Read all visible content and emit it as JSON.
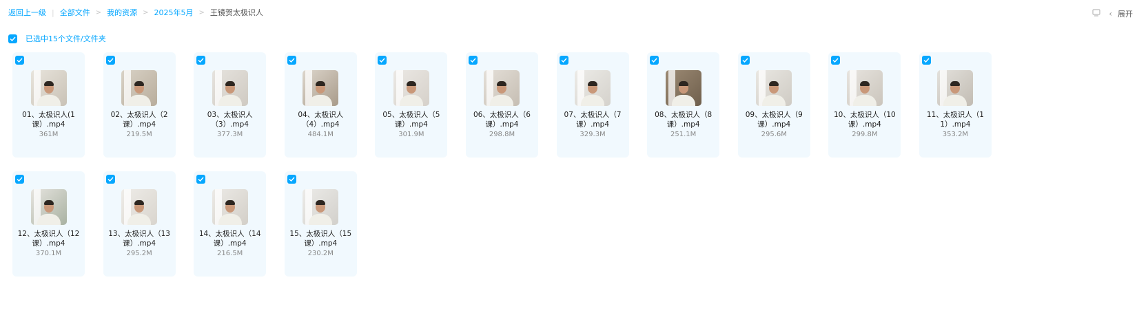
{
  "breadcrumb": {
    "back": "返回上一级",
    "all_files": "全部文件",
    "my_resources": "我的资源",
    "month": "2025年5月",
    "current": "王镜贺太极识人"
  },
  "top_right": {
    "expand_label": "展开",
    "icons": [
      "monitor-icon",
      "chevron-left-icon"
    ]
  },
  "selection": {
    "label": "已选中15个文件/文件夹"
  },
  "colors": {
    "accent": "#06a7ff",
    "card_bg": "#f1f9fe"
  },
  "files": [
    {
      "name": "01、太极识人(1课）.mp4",
      "size": "361M"
    },
    {
      "name": "02、太极识人（2课）.mp4",
      "size": "219.5M"
    },
    {
      "name": "03、太极识人（3）.mp4",
      "size": "377.3M"
    },
    {
      "name": "04、太极识人（4）.mp4",
      "size": "484.1M"
    },
    {
      "name": "05、太极识人（5课）.mp4",
      "size": "301.9M"
    },
    {
      "name": "06、太极识人（6课）.mp4",
      "size": "298.8M"
    },
    {
      "name": "07、太极识人（7课）.mp4",
      "size": "329.3M"
    },
    {
      "name": "08、太极识人（8课）.mp4",
      "size": "251.1M"
    },
    {
      "name": "09、太极识人（9课）.mp4",
      "size": "295.6M"
    },
    {
      "name": "10、太极识人（10课）.mp4",
      "size": "299.8M"
    },
    {
      "name": "11、太极识人（11）.mp4",
      "size": "353.2M"
    },
    {
      "name": "12、太极识人（12课）.mp4",
      "size": "370.1M"
    },
    {
      "name": "13、太极识人（13课）.mp4",
      "size": "295.2M"
    },
    {
      "name": "14、太极识人（14课）.mp4",
      "size": "216.5M"
    },
    {
      "name": "15、太极识人（15课）.mp4",
      "size": "230.2M"
    }
  ]
}
